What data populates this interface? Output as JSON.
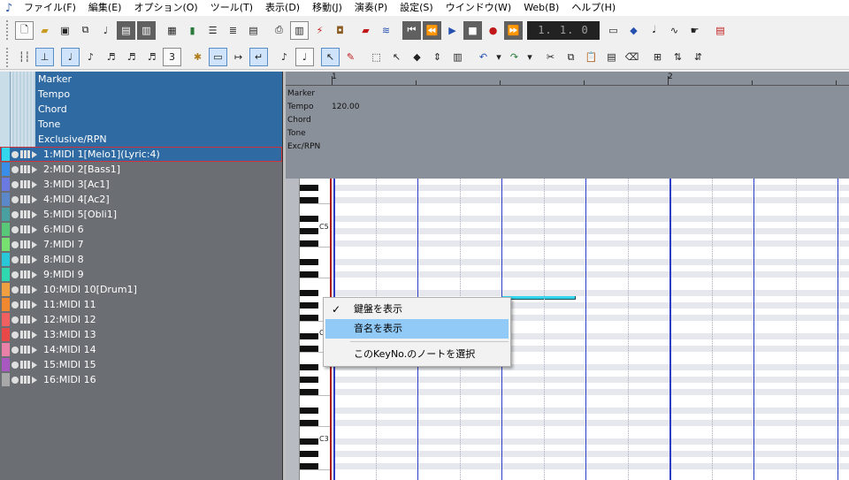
{
  "menubar": {
    "items": [
      "ファイル(F)",
      "編集(E)",
      "オプション(O)",
      "ツール(T)",
      "表示(D)",
      "移動(J)",
      "演奏(P)",
      "設定(S)",
      "ウインドウ(W)",
      "Web(B)",
      "ヘルプ(H)"
    ]
  },
  "toolbar1": {
    "position_display": "1.  1.   0"
  },
  "toolbar2": {
    "note_length_value": "3"
  },
  "tracks": {
    "system": [
      "Marker",
      "Tempo",
      "Chord",
      "Tone",
      "Exclusive/RPN"
    ],
    "midi": [
      {
        "label": "1:MIDI 1[Melo1](Lyric:4)",
        "color": "#33d6ea"
      },
      {
        "label": "2:MIDI 2[Bass1]",
        "color": "#3a8ee8"
      },
      {
        "label": "3:MIDI 3[Ac1]",
        "color": "#6a7ae0"
      },
      {
        "label": "4:MIDI 4[Ac2]",
        "color": "#5a88c8"
      },
      {
        "label": "5:MIDI 5[Obli1]",
        "color": "#4aa0a0"
      },
      {
        "label": "6:MIDI 6",
        "color": "#58c878"
      },
      {
        "label": "7:MIDI 7",
        "color": "#78e070"
      },
      {
        "label": "8:MIDI 8",
        "color": "#28c8d8"
      },
      {
        "label": "9:MIDI 9",
        "color": "#30d8b0"
      },
      {
        "label": "10:MIDI 10[Drum1]",
        "color": "#f0a040"
      },
      {
        "label": "11:MIDI 11",
        "color": "#f08830"
      },
      {
        "label": "12:MIDI 12",
        "color": "#f06060"
      },
      {
        "label": "13:MIDI 13",
        "color": "#e84848"
      },
      {
        "label": "14:MIDI 14",
        "color": "#e880a8"
      },
      {
        "label": "15:MIDI 15",
        "color": "#a858c0"
      },
      {
        "label": "16:MIDI 16",
        "color": "#a8a8a8"
      }
    ]
  },
  "ruler": {
    "measures": [
      "1",
      "2"
    ]
  },
  "events": {
    "labels": [
      "Marker",
      "Tempo",
      "Chord",
      "Tone",
      "Exc/RPN"
    ],
    "tempo_value": "120.00"
  },
  "piano": {
    "octave_labels": [
      "C5",
      "C4",
      "C3"
    ]
  },
  "context_menu": {
    "items": [
      {
        "label": "鍵盤を表示",
        "checked": true
      },
      {
        "label": "音名を表示",
        "checked": false
      },
      {
        "label": "このKeyNo.のノートを選択",
        "checked": false
      }
    ]
  }
}
